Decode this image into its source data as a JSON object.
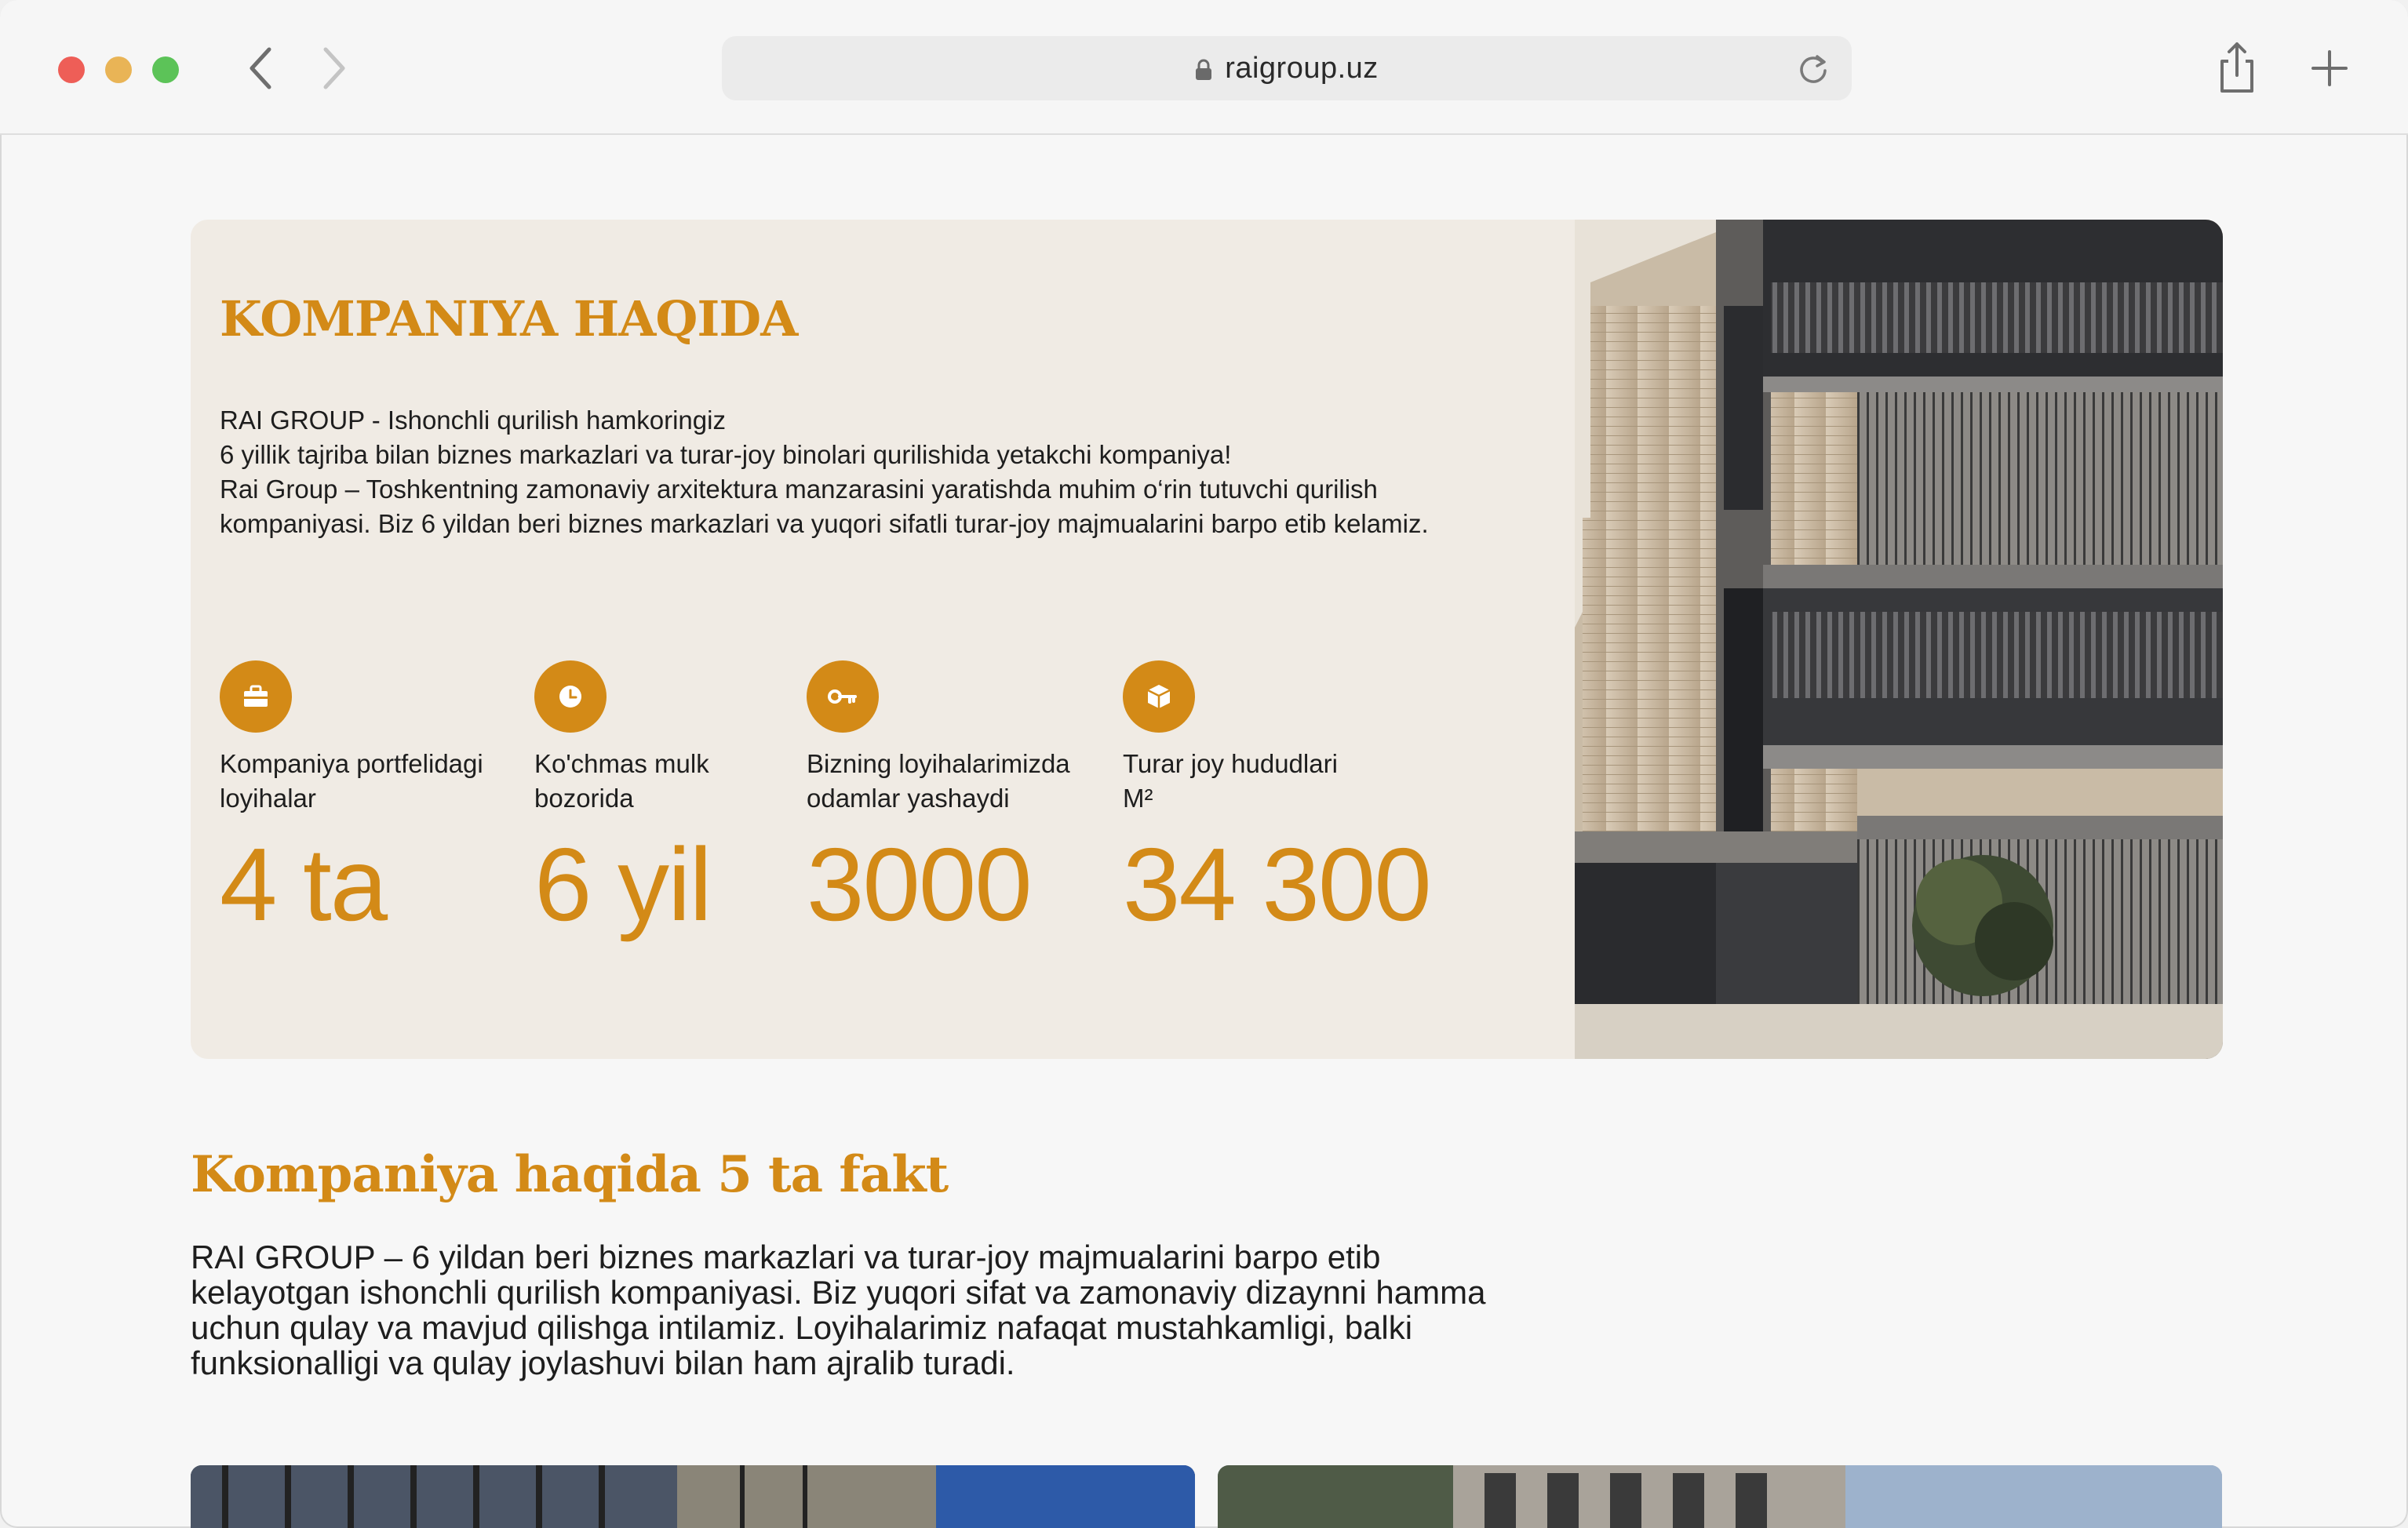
{
  "browser": {
    "url": "raigroup.uz"
  },
  "about": {
    "title": "KOMPANIYA HAQIDA",
    "paragraphs": [
      "RAI GROUP - Ishonchli qurilish hamkoringiz",
      "6 yillik tajriba bilan biznes markazlari va turar-joy binolari qurilishida yetakchi kompaniya!",
      "Rai Group – Toshkentning zamonaviy arxitektura manzarasini yaratishda muhim o‘rin tutuvchi qurilish kompaniyasi. Biz 6 yildan beri biznes markazlari va yuqori sifatli turar-joy majmualarini barpo etib kelamiz."
    ],
    "stats": [
      {
        "icon": "briefcase-icon",
        "label": "Kompaniya portfelidagi loyihalar",
        "value": "4 ta"
      },
      {
        "icon": "clock-icon",
        "label": "Ko'chmas mulk bozorida",
        "value": "6 yil"
      },
      {
        "icon": "key-icon",
        "label": "Bizning loyihalarimizda odamlar yashaydi",
        "value": "3000"
      },
      {
        "icon": "cube-icon",
        "label": "Turar joy hududlari M²",
        "value": "34 300"
      }
    ]
  },
  "facts": {
    "title": "Kompaniya haqida 5 ta fakt",
    "text": "RAI GROUP – 6 yildan beri biznes markazlari va turar-joy majmualarini barpo etib kelayotgan ishonchli qurilish kompaniyasi. Biz yuqori sifat va zamonaviy dizaynni hamma uchun qulay va mavjud qilishga intilamiz. Loyihalarimiz nafaqat mustahkamligi, balki funksionalligi va qulay joylashuvi bilan ham ajralib turadi."
  },
  "colors": {
    "accent": "#d38a17",
    "card_bg": "#f0ebe4",
    "page_bg": "#f7f7f7"
  }
}
